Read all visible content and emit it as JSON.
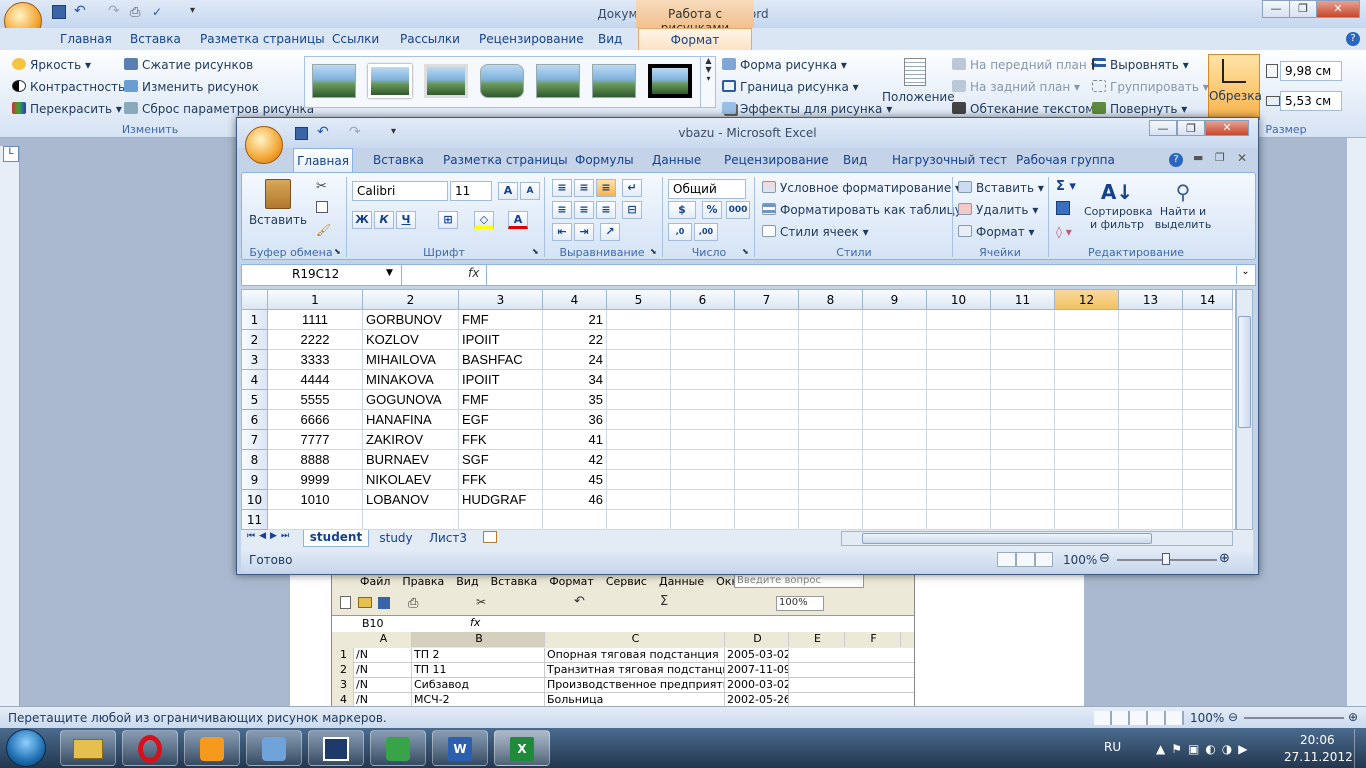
{
  "word": {
    "title": "Документ1 - Microsoft Word",
    "context_tab_group": "Работа с рисунками",
    "tabs": [
      "Главная",
      "Вставка",
      "Разметка страницы",
      "Ссылки",
      "Рассылки",
      "Рецензирование",
      "Вид"
    ],
    "active_tab": "Формат",
    "adjust": {
      "brightness": "Яркость",
      "contrast": "Контрастность",
      "recolor": "Перекрасить",
      "compress": "Сжатие рисунков",
      "change": "Изменить рисунок",
      "reset": "Сброс параметров рисунка",
      "label": "Изменить"
    },
    "picture_styles": {
      "shape": "Форма рисунка",
      "border": "Граница рисунка",
      "effects": "Эффекты для рисунка"
    },
    "arrange": {
      "position": "Положение",
      "front": "На передний план",
      "back": "На задний план",
      "wrap": "Обтекание текстом",
      "align": "Выровнять",
      "group": "Группировать",
      "rotate": "Повернуть"
    },
    "size": {
      "crop": "Обрезка",
      "height": "9,98 см",
      "width": "5,53 см",
      "label": "Размер"
    },
    "status_text": "Перетащите любой из ограничивающих рисунок маркеров.",
    "zoom": "100%"
  },
  "old_excel": {
    "menu": [
      "Файл",
      "Правка",
      "Вид",
      "Вставка",
      "Формат",
      "Сервис",
      "Данные",
      "Окно"
    ],
    "ask_placeholder": "Введите вопрос",
    "zoom": "100%",
    "name_box": "B10",
    "columns": [
      "A",
      "B",
      "C",
      "D",
      "E",
      "F"
    ],
    "rows": [
      {
        "n": "1",
        "a": "/N",
        "b": "ТП 2",
        "c": "Опорная тяговая подстанция",
        "d": "2005-03-02"
      },
      {
        "n": "2",
        "a": "/N",
        "b": "ТП 11",
        "c": "Транзитная тяговая подстанция",
        "d": "2007-11-09"
      },
      {
        "n": "3",
        "a": "/N",
        "b": "Сибзавод",
        "c": "Производственное предприятие",
        "d": "2000-03-02"
      },
      {
        "n": "4",
        "a": "/N",
        "b": "МСЧ-2",
        "c": "Больница",
        "d": "2002-05-26"
      }
    ]
  },
  "excel": {
    "title": "vbazu - Microsoft Excel",
    "tabs": [
      "Главная",
      "Вставка",
      "Разметка страницы",
      "Формулы",
      "Данные",
      "Рецензирование",
      "Вид",
      "Нагрузочный тест",
      "Рабочая группа"
    ],
    "clipboard": {
      "paste": "Вставить",
      "label": "Буфер обмена"
    },
    "font": {
      "name": "Calibri",
      "size": "11",
      "label": "Шрифт"
    },
    "alignment_label": "Выравнивание",
    "number": {
      "format": "Общий",
      "label": "Число"
    },
    "styles": {
      "conditional": "Условное форматирование",
      "as_table": "Форматировать как таблицу",
      "cell_styles": "Стили ячеек",
      "label": "Стили"
    },
    "cells": {
      "insert": "Вставить",
      "delete": "Удалить",
      "format": "Формат",
      "label": "Ячейки"
    },
    "editing": {
      "sort": "Сортировка и фильтр",
      "find": "Найти и выделить",
      "label": "Редактирование"
    },
    "name_box": "R19C12",
    "columns": [
      "1",
      "2",
      "3",
      "4",
      "5",
      "6",
      "7",
      "8",
      "9",
      "10",
      "11",
      "12",
      "13",
      "14"
    ],
    "rows": [
      {
        "n": "1",
        "c1": "1111",
        "c2": "GORBUNOV",
        "c3": "FMF",
        "c4": "21"
      },
      {
        "n": "2",
        "c1": "2222",
        "c2": "KOZLOV",
        "c3": "IPOIIT",
        "c4": "22"
      },
      {
        "n": "3",
        "c1": "3333",
        "c2": "MIHAILOVA",
        "c3": "BASHFAC",
        "c4": "24"
      },
      {
        "n": "4",
        "c1": "4444",
        "c2": "MINAKOVA",
        "c3": "IPOIIT",
        "c4": "34"
      },
      {
        "n": "5",
        "c1": "5555",
        "c2": "GOGUNOVA",
        "c3": "FMF",
        "c4": "35"
      },
      {
        "n": "6",
        "c1": "6666",
        "c2": "HANAFINA",
        "c3": "EGF",
        "c4": "36"
      },
      {
        "n": "7",
        "c1": "7777",
        "c2": "ZAKIROV",
        "c3": "FFK",
        "c4": "41"
      },
      {
        "n": "8",
        "c1": "8888",
        "c2": "BURNAEV",
        "c3": "SGF",
        "c4": "42"
      },
      {
        "n": "9",
        "c1": "9999",
        "c2": "NIKOLAEV",
        "c3": "FFK",
        "c4": "45"
      },
      {
        "n": "10",
        "c1": "1010",
        "c2": "LOBANOV",
        "c3": "HUDGRAF",
        "c4": "46"
      },
      {
        "n": "11",
        "c1": "",
        "c2": "",
        "c3": "",
        "c4": ""
      }
    ],
    "sheets": [
      "student",
      "study",
      "Лист3"
    ],
    "status": "Готово",
    "zoom": "100%"
  },
  "taskbar": {
    "lang": "RU",
    "time": "20:06",
    "date": "27.11.2012"
  }
}
